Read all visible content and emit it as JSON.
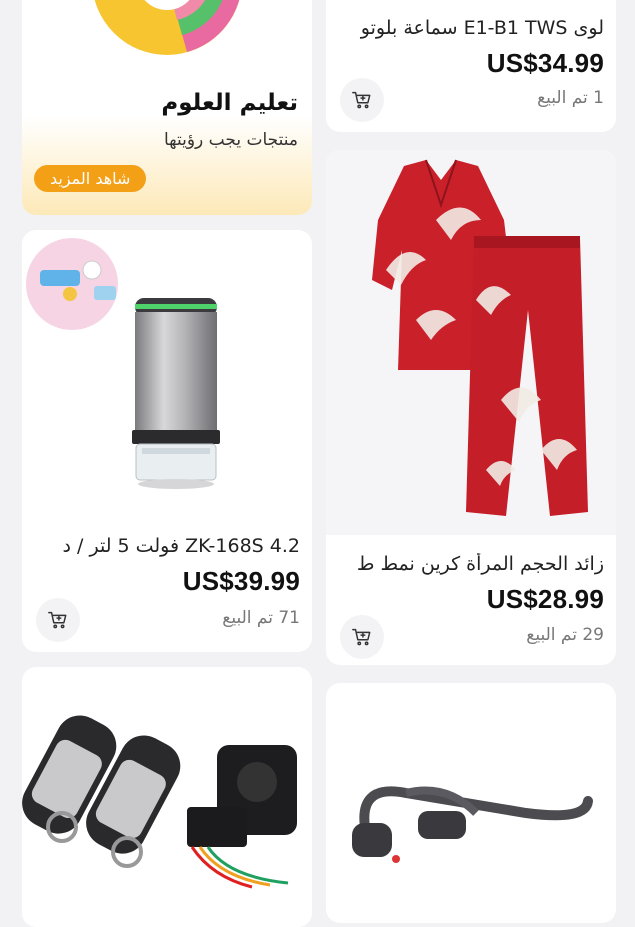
{
  "promo": {
    "title": "تعليم العلوم",
    "subtitle": "منتجات يجب رؤيتها",
    "button": "شاهد المزيد"
  },
  "products": [
    {
      "title": "لوى E1-B1 TWS سماعة بلوتو",
      "price": "US$34.99",
      "sold": "1 تم البيع"
    },
    {
      "title": "زائد الحجم المرأة كرين نمط ط",
      "price": "US$28.99",
      "sold": "29 تم البيع"
    },
    {
      "title": "ZK-168S 4.2 فولت 5 لتر / د",
      "price": "US$39.99",
      "sold": "71 تم البيع"
    }
  ],
  "icons": {
    "cart": "cart-plus-icon"
  },
  "colors": {
    "promo_button": "#f3a017",
    "pajama_red": "#c9202a"
  }
}
